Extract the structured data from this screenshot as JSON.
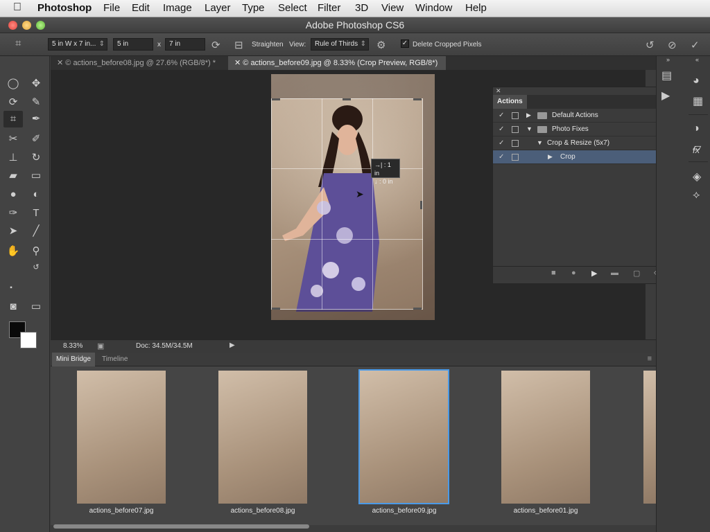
{
  "menubar": {
    "apple_icon": "",
    "app_name": "Photoshop",
    "items": [
      "File",
      "Edit",
      "Image",
      "Layer",
      "Type",
      "Select",
      "Filter",
      "3D",
      "View",
      "Window",
      "Help"
    ]
  },
  "window": {
    "title": "Adobe Photoshop CS6"
  },
  "options_bar": {
    "ratio_preset": "5 in W x 7 in...",
    "width": "5 in",
    "times": "x",
    "height": "7 in",
    "straighten_label": "Straighten",
    "view_label": "View:",
    "view_value": "Rule of Thirds",
    "delete_cropped_label": "Delete Cropped Pixels",
    "delete_cropped_checked": "✓"
  },
  "tabs": [
    {
      "label": "© actions_before08.jpg @ 27.6% (RGB/8*) *"
    },
    {
      "label": "© actions_before09.jpg @ 8.33% (Crop Preview, RGB/8*)"
    }
  ],
  "tooltip": {
    "line1": "→| : 1 in",
    "line2": "↓ : 0 in"
  },
  "status": {
    "zoom": "8.33%",
    "doc": "Doc: 34.5M/34.5M"
  },
  "bridge": {
    "tabs": [
      "Mini Bridge",
      "Timeline"
    ],
    "thumbs": [
      {
        "name": "actions_before07.jpg"
      },
      {
        "name": "actions_before08.jpg"
      },
      {
        "name": "actions_before09.jpg"
      },
      {
        "name": "actions_before01.jpg"
      }
    ]
  },
  "actions_panel": {
    "title": "Actions",
    "rows": [
      {
        "label": "Default Actions",
        "check": "✓"
      },
      {
        "label": "Photo Fixes",
        "check": "✓"
      },
      {
        "label": "Crop & Resize (5x7)",
        "check": "✓"
      },
      {
        "label": "Crop",
        "check": "✓"
      }
    ]
  }
}
